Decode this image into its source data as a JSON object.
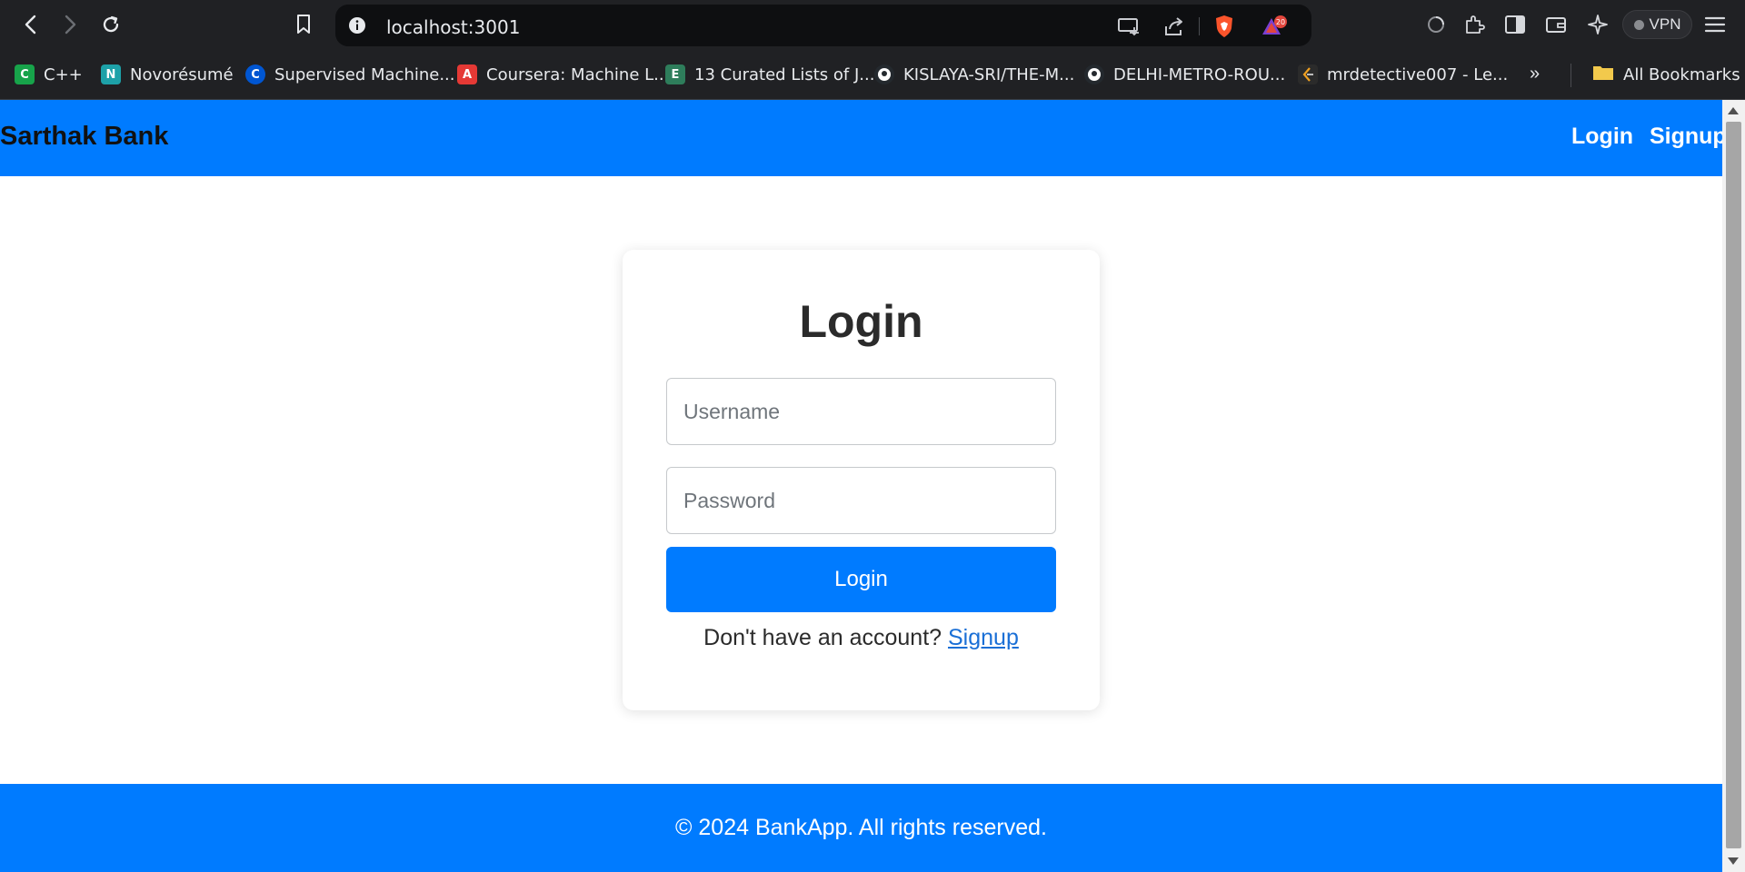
{
  "browser": {
    "url": "localhost:3001",
    "shields_badge": "20",
    "vpn_label": "VPN"
  },
  "bookmarks": [
    {
      "label": "C++",
      "icon": "c-plus-plus-icon",
      "color": "#17a34a",
      "glyph": "C"
    },
    {
      "label": "Novorésumé",
      "icon": "novoresume-icon",
      "color": "#1da1a8",
      "glyph": "N"
    },
    {
      "label": "Supervised Machine...",
      "icon": "coursera-icon",
      "color": "#0056d2",
      "glyph": "C"
    },
    {
      "label": "Coursera: Machine L...",
      "icon": "bookmark-red-icon",
      "color": "#e53935",
      "glyph": "A"
    },
    {
      "label": "13 Curated Lists of J...",
      "icon": "evernote-icon",
      "color": "#2e7d5b",
      "glyph": "E"
    },
    {
      "label": "KISLAYA-SRI/THE-M...",
      "icon": "github-icon",
      "color": "#24292e",
      "glyph": "●"
    },
    {
      "label": "DELHI-METRO-ROU...",
      "icon": "github-icon",
      "color": "#24292e",
      "glyph": "●"
    },
    {
      "label": "mrdetective007 - Le...",
      "icon": "leetcode-icon",
      "color": "#2b2b2b",
      "glyph": "L"
    }
  ],
  "bookmarks_more": "»",
  "all_bookmarks_label": "All Bookmarks",
  "navbar": {
    "brand": "Sarthak Bank",
    "links": [
      "Login",
      "Signup"
    ]
  },
  "login_form": {
    "title": "Login",
    "username_placeholder": "Username",
    "password_placeholder": "Password",
    "submit_label": "Login",
    "signup_prompt": "Don't have an account?",
    "signup_link": "Signup"
  },
  "footer": {
    "text": "© 2024 BankApp. All rights reserved."
  },
  "colors": {
    "primary": "#007bff",
    "chrome": "#202124"
  }
}
